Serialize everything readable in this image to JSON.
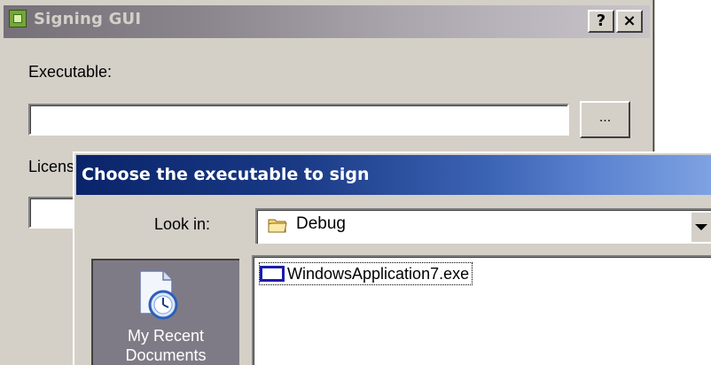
{
  "signing_window": {
    "title": "Signing GUI",
    "help_button": "?",
    "close_button": "×",
    "executable_label": "Executable:",
    "executable_value": "",
    "browse_button": "...",
    "license_label": "License:",
    "license_value": ""
  },
  "open_dialog": {
    "title": "Choose the executable to sign",
    "look_in_label": "Look in:",
    "look_in_value": "Debug",
    "places": [
      {
        "label": "My Recent Documents",
        "icon": "recent-documents-icon"
      }
    ],
    "files": [
      {
        "name": "WindowsApplication7.exe",
        "icon": "exe-icon",
        "focused": true
      }
    ]
  },
  "colors": {
    "dialog_face": "#d4d0c8",
    "active_title_start": "#0a246a",
    "active_title_end": "#7ea2e2",
    "places_bar": "#7f7b86"
  }
}
